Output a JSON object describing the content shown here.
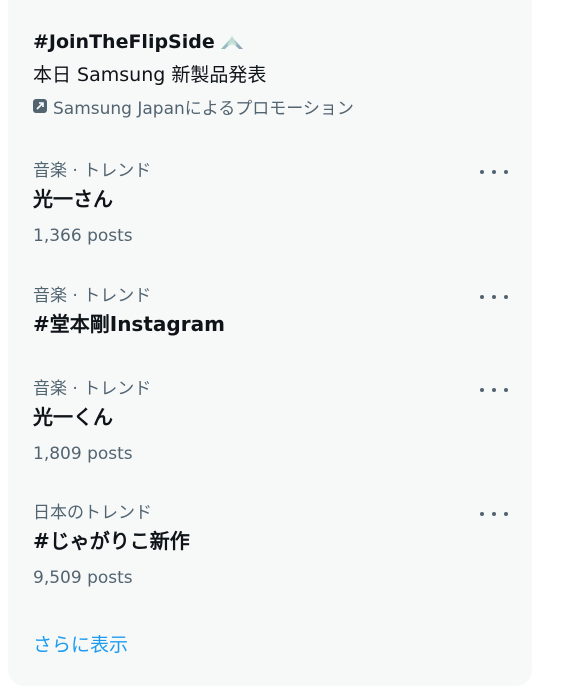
{
  "promo": {
    "tag": "#JoinTheFlipSide",
    "subtitle": "本日 Samsung 新製品発表",
    "promoted_by": "Samsung Japanによるプロモーション"
  },
  "trends": [
    {
      "meta": "音楽 · トレンド",
      "title": "光一さん",
      "count": "1,366 posts"
    },
    {
      "meta": "音楽 · トレンド",
      "title": "#堂本剛Instagram",
      "count": ""
    },
    {
      "meta": "音楽 · トレンド",
      "title": "光一くん",
      "count": "1,809 posts"
    },
    {
      "meta": "日本のトレンド",
      "title": "#じゃがりこ新作",
      "count": "9,509 posts"
    }
  ],
  "show_more": "さらに表示",
  "colors": {
    "panel_bg": "#f7f9f9",
    "text_primary": "#0f1419",
    "text_secondary": "#536471",
    "link": "#1d9bf0"
  },
  "icons": {
    "promo_tag_icon": "flip-phone-icon",
    "promoted_badge": "promoted-arrow-icon",
    "more": "more-dots-icon"
  }
}
